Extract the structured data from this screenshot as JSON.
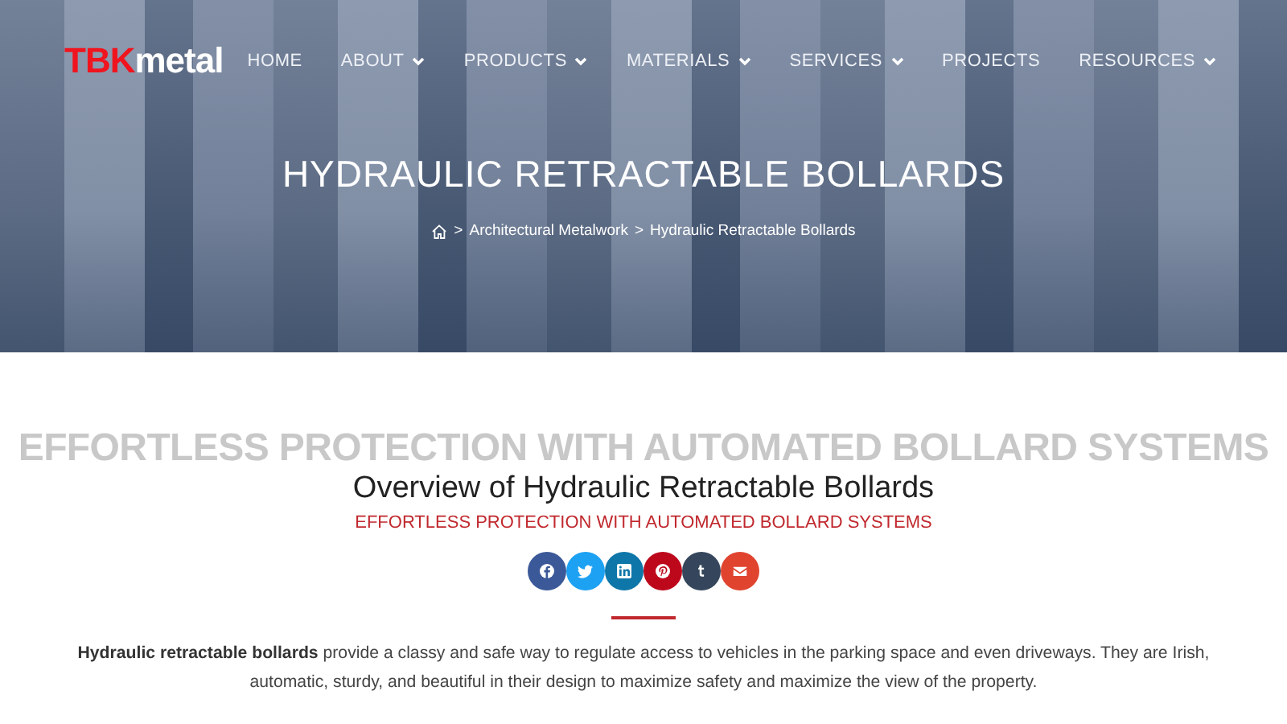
{
  "header": {
    "logo": {
      "brand": "TBK",
      "suffix": "metal"
    },
    "nav": [
      {
        "label": "HOME",
        "dropdown": false
      },
      {
        "label": "ABOUT",
        "dropdown": true
      },
      {
        "label": "PRODUCTS",
        "dropdown": true
      },
      {
        "label": "MATERIALS",
        "dropdown": true
      },
      {
        "label": "SERVICES",
        "dropdown": true
      },
      {
        "label": "PROJECTS",
        "dropdown": false
      },
      {
        "label": "RESOURCES",
        "dropdown": true
      }
    ]
  },
  "hero": {
    "title": "HYDRAULIC RETRACTABLE BOLLARDS",
    "breadcrumb": [
      {
        "separator": ">",
        "label": "Architectural Metalwork"
      },
      {
        "separator": ">",
        "label": "Hydraulic Retractable Bollards"
      }
    ]
  },
  "overview": {
    "background_text": "EFFORTLESS PROTECTION WITH AUTOMATED BOLLARD SYSTEMS",
    "heading": "Overview of Hydraulic Retractable Bollards",
    "subheading": "EFFORTLESS PROTECTION WITH AUTOMATED BOLLARD SYSTEMS",
    "share": [
      {
        "kind": "facebook",
        "color": "#3b5998"
      },
      {
        "kind": "twitter",
        "color": "#1da1f2"
      },
      {
        "kind": "linkedin",
        "color": "#0e76a8"
      },
      {
        "kind": "pinterest",
        "color": "#bd081c"
      },
      {
        "kind": "tumblr",
        "color": "#35465c"
      },
      {
        "kind": "email",
        "color": "#e0442f"
      }
    ],
    "paragraph": "**Hydraulic retractable bollards** provide a classy and safe way to regulate access to vehicles in the parking space and even driveways. They are Irish, automatic, sturdy, and beautiful in their design to maximize safety and maximize the view of the property."
  }
}
